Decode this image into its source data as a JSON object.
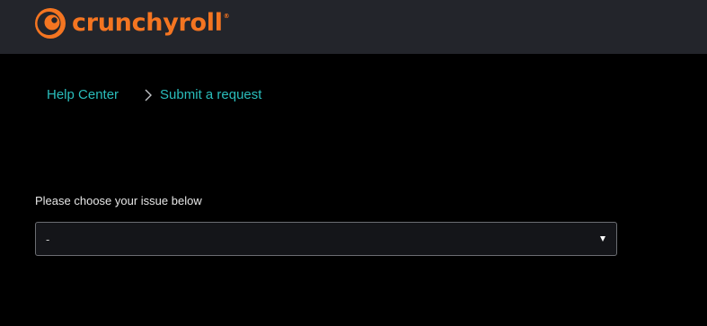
{
  "header": {
    "logo_text": "crunchyroll",
    "logo_reg": "®",
    "logo_icon": "crunchyroll-logo-icon",
    "background_color": "#23252b",
    "brand_color": "#f47521"
  },
  "breadcrumb": {
    "items": [
      {
        "label": "Help Center"
      },
      {
        "label": "Submit a request"
      }
    ],
    "separator_icon": "chevron-right-icon",
    "link_color": "#2abdbb"
  },
  "form": {
    "issue_label": "Please choose your issue below",
    "issue_select": {
      "selected_value": "-",
      "arrow_icon": "caret-down-icon"
    }
  }
}
